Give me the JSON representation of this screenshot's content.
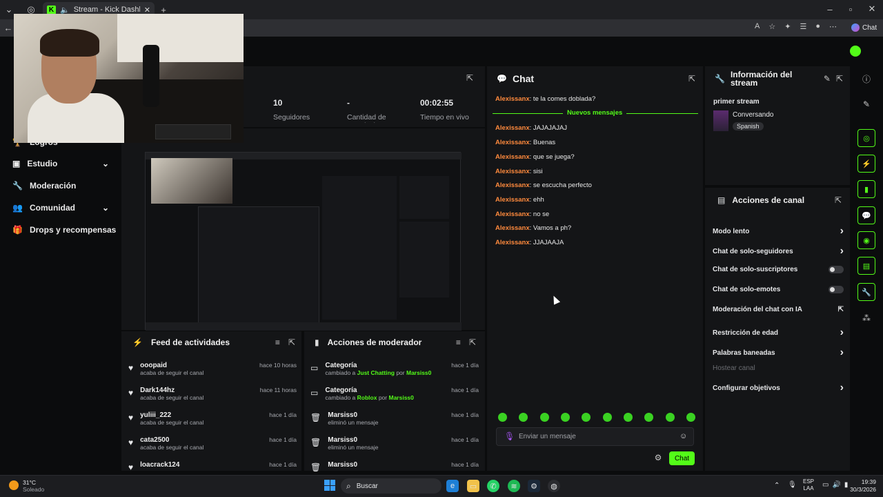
{
  "browser": {
    "tab_title": "Stream - Kick Dashboard",
    "new_tab": "+",
    "chat_button": "Chat"
  },
  "nav": [
    {
      "label": "Logros",
      "icon": "trophy-icon"
    },
    {
      "label": "Estudio",
      "icon": "studio-icon",
      "chevron": true
    },
    {
      "label": "Moderación",
      "icon": "wrench-icon"
    },
    {
      "label": "Comunidad",
      "icon": "people-icon",
      "chevron": true
    },
    {
      "label": "Drops y recompensas",
      "icon": "gift-icon"
    }
  ],
  "stats": {
    "followers_value": "10",
    "followers_label": "Seguidores",
    "subs_value": "-",
    "subs_label": "Cantidad de suscripciones",
    "live_value": "00:02:55",
    "live_label": "Tiempo en vivo"
  },
  "chat": {
    "title": "Chat",
    "new_messages": "Nuevos mensajes",
    "messages": [
      {
        "user": "Alexissanx",
        "text": ": te la comes doblada?"
      },
      {
        "user": "Alexissanx",
        "text": ": JAJAJAJAJ"
      },
      {
        "user": "Alexissanx",
        "text": ": Buenas"
      },
      {
        "user": "Alexissanx",
        "text": ": que se juega?"
      },
      {
        "user": "Alexissanx",
        "text": ": sisi"
      },
      {
        "user": "Alexissanx",
        "text": ": se escucha perfecto"
      },
      {
        "user": "Alexissanx",
        "text": ": ehh"
      },
      {
        "user": "Alexissanx",
        "text": ": no se"
      },
      {
        "user": "Alexissanx",
        "text": ": Vamos a ph?"
      },
      {
        "user": "Alexissanx",
        "text": ": JJAJAAJA"
      }
    ],
    "input_placeholder": "Enviar un mensaje",
    "send_label": "Chat"
  },
  "stream_info": {
    "title": "Información del stream",
    "stream_title": "primer stream",
    "category": "Conversando",
    "language": "Spanish"
  },
  "channel_actions": {
    "title": "Acciones de canal",
    "items": [
      {
        "label": "Modo lento",
        "control": "chevron"
      },
      {
        "label": "Chat de solo-seguidores",
        "control": "chevron"
      },
      {
        "label": "Chat de solo-suscriptores",
        "control": "toggle"
      },
      {
        "label": "Chat de solo-emotes",
        "control": "toggle"
      },
      {
        "label": "Moderación del chat con IA",
        "control": "external"
      },
      {
        "label": "Restricción de edad",
        "control": "chevron"
      },
      {
        "label": "Palabras baneadas",
        "control": "chevron"
      },
      {
        "label": "Hostear canal",
        "control": "none",
        "disabled": true
      },
      {
        "label": "Configurar objetivos",
        "control": "chevron"
      }
    ]
  },
  "activity_feed": {
    "title": "Feed de actividades",
    "items": [
      {
        "user": "ooopaid",
        "action": "acaba de seguir el canal",
        "time": "hace 10 horas"
      },
      {
        "user": "Dark144hz",
        "action": "acaba de seguir el canal",
        "time": "hace 11 horas"
      },
      {
        "user": "yuliii_222",
        "action": "acaba de seguir el canal",
        "time": "hace 1 día"
      },
      {
        "user": "cata2500",
        "action": "acaba de seguir el canal",
        "time": "hace 1 día"
      },
      {
        "user": "loacrack124",
        "action": "",
        "time": "hace 1 día"
      }
    ]
  },
  "mod_actions": {
    "title": "Acciones de moderador",
    "items": [
      {
        "title": "Categoría",
        "pre": "cambiado a ",
        "hl": "Just Chatting",
        "mid": " por ",
        "by": "Marsiss0",
        "time": "hace 1 día"
      },
      {
        "title": "Categoría",
        "pre": "cambiado a ",
        "hl": "Roblox",
        "mid": " por ",
        "by": "Marsiss0",
        "time": "hace 1 día"
      },
      {
        "title": "Marsiss0",
        "pre": "eliminó un mensaje",
        "hl": "",
        "mid": "",
        "by": "",
        "time": "hace 1 día"
      },
      {
        "title": "Marsiss0",
        "pre": "eliminó un mensaje",
        "hl": "",
        "mid": "",
        "by": "",
        "time": "hace 1 día"
      },
      {
        "title": "Marsiss0",
        "pre": "",
        "hl": "",
        "mid": "",
        "by": "",
        "time": "hace 1 día"
      }
    ]
  },
  "taskbar": {
    "weather_temp": "31°C",
    "weather_desc": "Soleado",
    "search": "Buscar",
    "lang1": "ESP",
    "lang2": "LAA",
    "time": "19:39",
    "date": "30/3/2026"
  },
  "colors": {
    "accent": "#53fc18",
    "username": "#ff8a3d",
    "bg": "#0b0c0d",
    "panel": "#141517"
  }
}
